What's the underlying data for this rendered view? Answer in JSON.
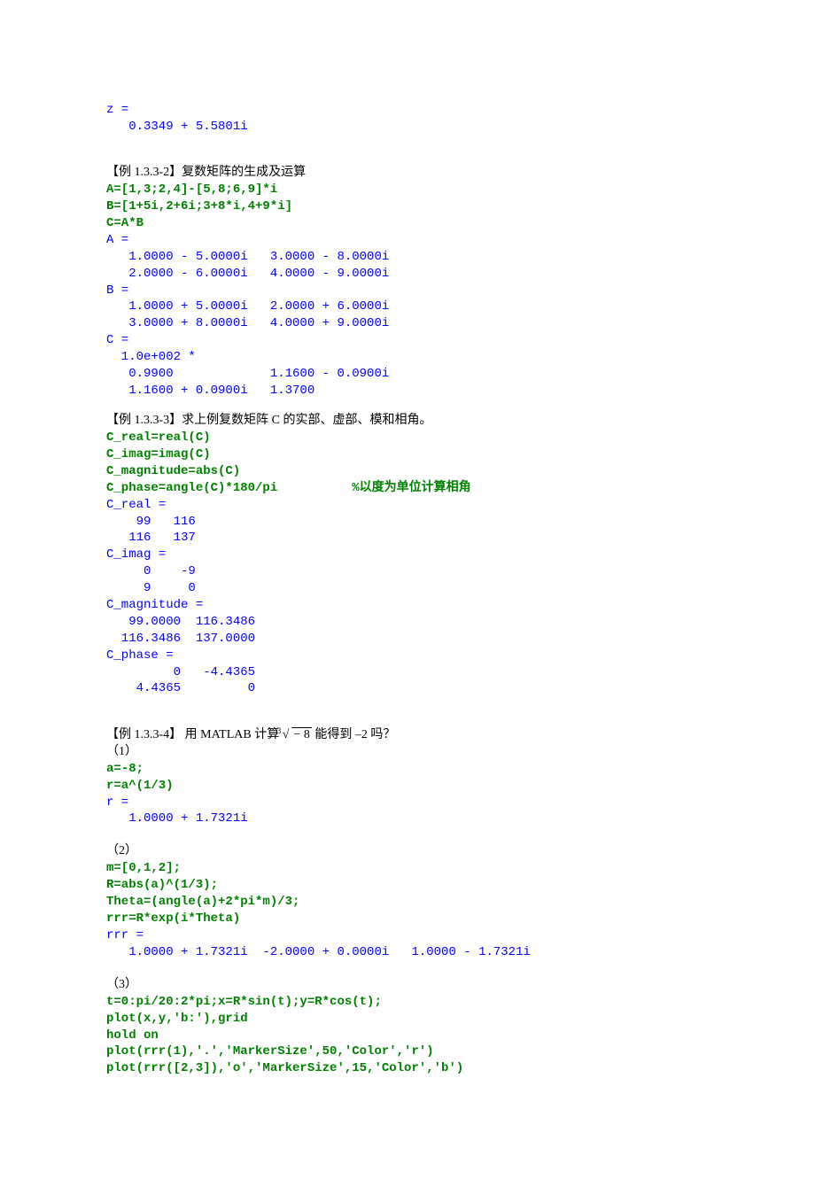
{
  "block1": {
    "l1": "z =",
    "l2": "   0.3349 + 5.5801i"
  },
  "ex2": {
    "title_pre": "【例 1.3.3-2】",
    "title_rest": "复数矩阵的生成及运算",
    "c1": "A=[1,3;2,4]-[5,8;6,9]*i",
    "c2": "B=[1+5i,2+6i;3+8*i,4+9*i]",
    "c3": "C=A*B",
    "o1": "A =",
    "o2": "   1.0000 - 5.0000i   3.0000 - 8.0000i",
    "o3": "   2.0000 - 6.0000i   4.0000 - 9.0000i",
    "o4": "B =",
    "o5": "   1.0000 + 5.0000i   2.0000 + 6.0000i",
    "o6": "   3.0000 + 8.0000i   4.0000 + 9.0000i",
    "o7": "C =",
    "o8": "  1.0e+002 *",
    "o9": "   0.9900             1.1600 - 0.0900i",
    "o10": "   1.1600 + 0.0900i   1.3700"
  },
  "ex3": {
    "title_pre": "【例 1.3.3-3】",
    "title_rest": "求上例复数矩阵 C 的实部、虚部、模和相角。",
    "c1": "C_real=real(C)",
    "c2": "C_imag=imag(C)",
    "c3": "C_magnitude=abs(C)",
    "c4a": "C_phase=angle(C)*180/pi",
    "c4b": "          %以度为单位计算相角",
    "o1": "C_real =",
    "o2": "    99   116",
    "o3": "   116   137",
    "o4": "C_imag =",
    "o5": "     0    -9",
    "o6": "     9     0",
    "o7": "C_magnitude =",
    "o8": "   99.0000  116.3486",
    "o9": "  116.3486  137.0000",
    "o10": "C_phase =",
    "o11": "         0   -4.4365",
    "o12": "    4.4365         0"
  },
  "ex4": {
    "title_pre": "【例 1.3.3-4】",
    "title_mid": " 用 MATLAB 计算 ",
    "rad_index": "3",
    "rad_symbol": "√",
    "radicand": "− 8",
    "title_end": " 能得到 –2 吗？",
    "p1": "（1）",
    "c1": "a=-8;",
    "c2": "r=a^(1/3)",
    "o1": "r =",
    "o2": "   1.0000 + 1.7321i",
    "p2": "（2）",
    "c3": "m=[0,1,2];",
    "c4": "R=abs(a)^(1/3);",
    "c5": "Theta=(angle(a)+2*pi*m)/3;",
    "c6": "rrr=R*exp(i*Theta)",
    "o3": "rrr =",
    "o4": "   1.0000 + 1.7321i  -2.0000 + 0.0000i   1.0000 - 1.7321i",
    "p3": "（3）",
    "c7": "t=0:pi/20:2*pi;x=R*sin(t);y=R*cos(t);",
    "c8": "plot(x,y,'b:'),grid",
    "c9": "hold on",
    "c10": "plot(rrr(1),'.','MarkerSize',50,'Color','r')",
    "c11": "plot(rrr([2,3]),'o','MarkerSize',15,'Color','b')"
  }
}
